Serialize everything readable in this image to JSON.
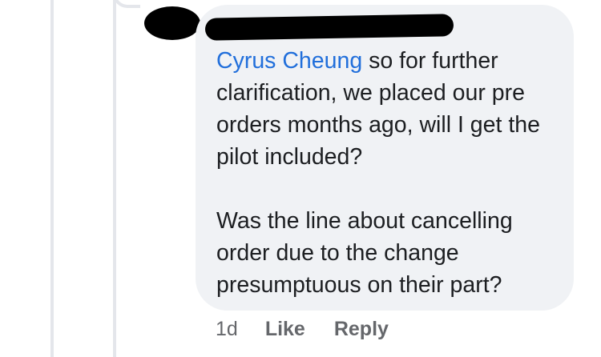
{
  "comment": {
    "author": "",
    "mention": "Cyrus Cheung",
    "paragraph1_rest": " so for further clarification, we placed our pre orders months ago, will I get the pilot included?",
    "paragraph2": "Was the line about cancelling order due to the change presumptuous on their part?"
  },
  "actions": {
    "time": "1d",
    "like_label": "Like",
    "reply_label": "Reply"
  },
  "colors": {
    "bubble": "#f0f2f5",
    "mention": "#216fdb",
    "text": "#1c1e21",
    "muted": "#65676b",
    "thread_line": "#e4e6eb"
  }
}
